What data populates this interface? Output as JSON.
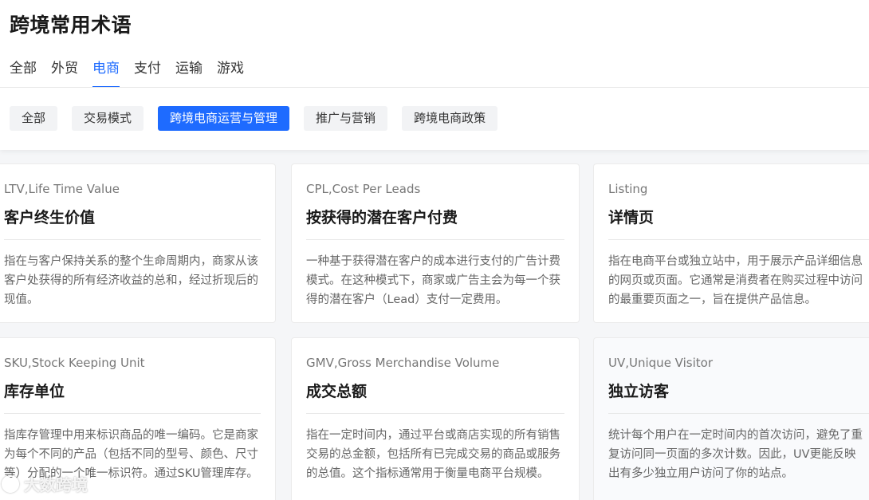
{
  "page": {
    "title": "跨境常用术语"
  },
  "tabs": [
    {
      "label": "全部"
    },
    {
      "label": "外贸"
    },
    {
      "label": "电商",
      "active": true
    },
    {
      "label": "支付"
    },
    {
      "label": "运输"
    },
    {
      "label": "游戏"
    }
  ],
  "chips": [
    {
      "label": "全部"
    },
    {
      "label": "交易模式"
    },
    {
      "label": "跨境电商运营与管理",
      "active": true
    },
    {
      "label": "推广与营销"
    },
    {
      "label": "跨境电商政策"
    }
  ],
  "cards": [
    {
      "abbr": "LTV,Life Time Value",
      "term": "客户终生价值",
      "desc": "指在与客户保持关系的整个生命周期内，商家从该客户处获得的所有经济收益的总和，经过折现后的现值。"
    },
    {
      "abbr": "CPL,Cost Per Leads",
      "term": "按获得的潜在客户付费",
      "desc": "一种基于获得潜在客户的成本进行支付的广告计费模式。在这种模式下，商家或广告主会为每一个获得的潜在客户（Lead）支付一定费用。"
    },
    {
      "abbr": "Listing",
      "term": "详情页",
      "desc": "指在电商平台或独立站中，用于展示产品详细信息的网页或页面。它通常是消费者在购买过程中访问的最重要页面之一，旨在提供产品信息。"
    },
    {
      "abbr": "SKU,Stock Keeping Unit",
      "term": "库存单位",
      "desc": "指库存管理中用来标识商品的唯一编码。它是商家为每个不同的产品（包括不同的型号、颜色、尺寸等）分配的一个唯一标识符。通过SKU管理库存。"
    },
    {
      "abbr": "GMV,Gross Merchandise Volume",
      "term": "成交总额",
      "desc": "指在一定时间内，通过平台或商店实现的所有销售交易的总金额，包括所有已完成交易的商品或服务的总值。这个指标通常用于衡量电商平台规模。"
    },
    {
      "abbr": "UV,Unique Visitor",
      "term": "独立访客",
      "desc": "统计每个用户在一定时间内的首次访问，避免了重复访问同一页面的多次计数。因此，UV更能反映出有多少独立用户访问了你的站点。"
    }
  ],
  "watermark": {
    "text": "大数跨境"
  },
  "colors": {
    "accent": "#1e6bff",
    "background": "#f5f6f8"
  }
}
